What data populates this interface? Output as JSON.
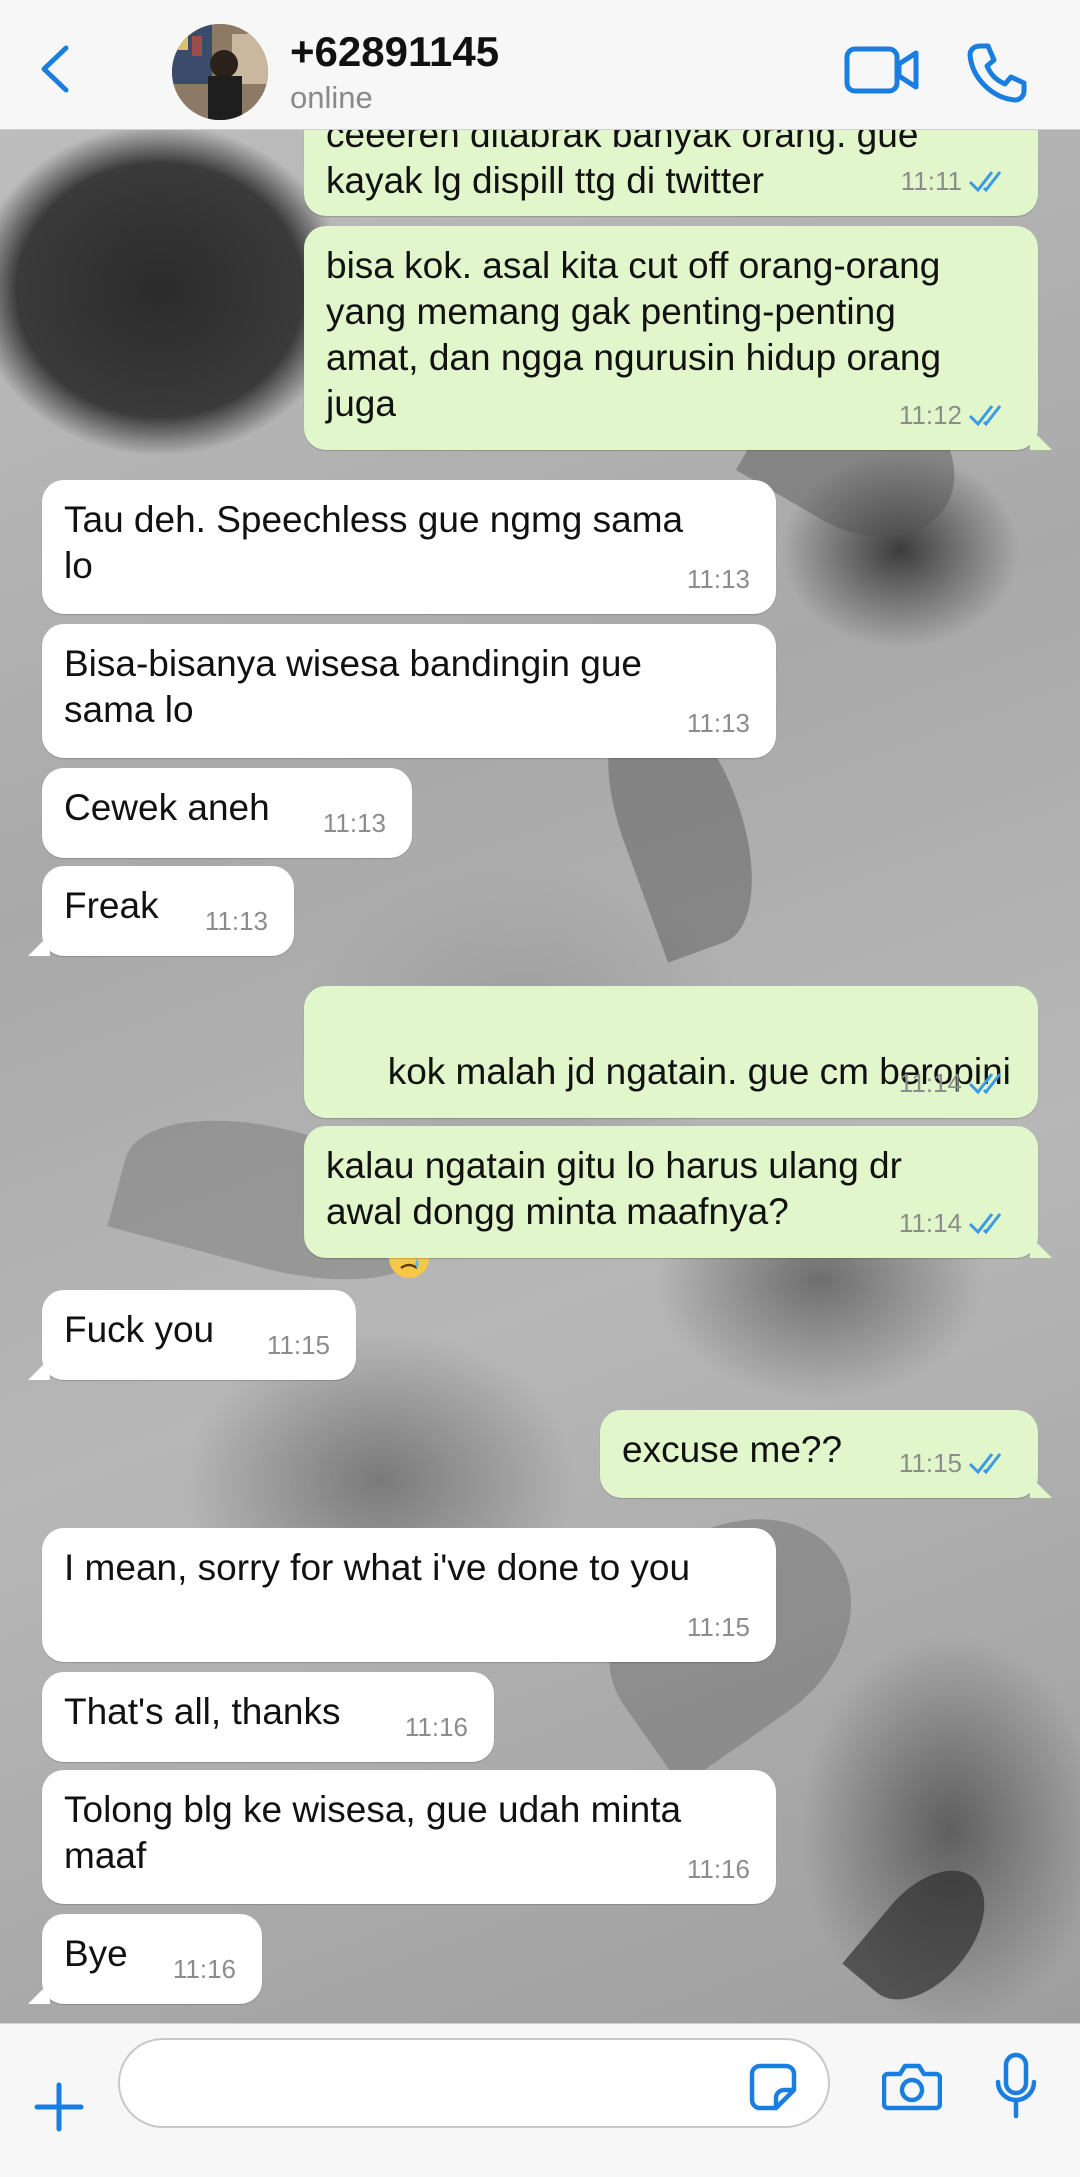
{
  "header": {
    "contact_name": "+62891145",
    "status": "online"
  },
  "colors": {
    "accent": "#1a7ee0",
    "outgoing_bubble": "#e1f7cb",
    "incoming_bubble": "#ffffff",
    "read_ticks": "#3b9ae8"
  },
  "messages": [
    {
      "direction": "out",
      "text": "ceeeren ditabrak banyak orang. gue\nkayak lg dispill ttg di twitter",
      "time": "11:11",
      "read": true
    },
    {
      "direction": "out",
      "text": "bisa kok. asal kita cut off orang-orang\nyang memang gak penting-penting\namat, dan ngga ngurusin hidup orang\njuga",
      "time": "11:12",
      "read": true
    },
    {
      "direction": "in",
      "text": "Tau deh. Speechless gue ngmg sama\nlo",
      "time": "11:13"
    },
    {
      "direction": "in",
      "text": "Bisa-bisanya wisesa bandingin gue\nsama lo",
      "time": "11:13"
    },
    {
      "direction": "in",
      "text": "Cewek aneh",
      "time": "11:13"
    },
    {
      "direction": "in",
      "text": "Freak",
      "time": "11:13"
    },
    {
      "direction": "out",
      "text": "kok malah jd ngatain. gue cm beropini",
      "emoji": "crying-face-emoji",
      "time": "11:14",
      "read": true
    },
    {
      "direction": "out",
      "text": "kalau ngatain gitu lo harus ulang dr\nawal dongg minta maafnya?",
      "time": "11:14",
      "read": true
    },
    {
      "direction": "in",
      "text": "Fuck you",
      "time": "11:15"
    },
    {
      "direction": "out",
      "text": "excuse me??",
      "time": "11:15",
      "read": true
    },
    {
      "direction": "in",
      "text": "I mean, sorry for what i've done to you",
      "time": "11:15"
    },
    {
      "direction": "in",
      "text": "That's all, thanks",
      "time": "11:16"
    },
    {
      "direction": "in",
      "text": "Tolong blg ke wisesa, gue udah minta\nmaaf",
      "time": "11:16"
    },
    {
      "direction": "in",
      "text": "Bye",
      "time": "11:16"
    }
  ],
  "input": {
    "value": "",
    "placeholder": ""
  },
  "icons": {
    "back": "chevron-left-icon",
    "video": "video-camera-icon",
    "call": "phone-icon",
    "attach": "plus-icon",
    "sticker": "sticker-icon",
    "camera": "camera-icon",
    "mic": "microphone-icon"
  }
}
